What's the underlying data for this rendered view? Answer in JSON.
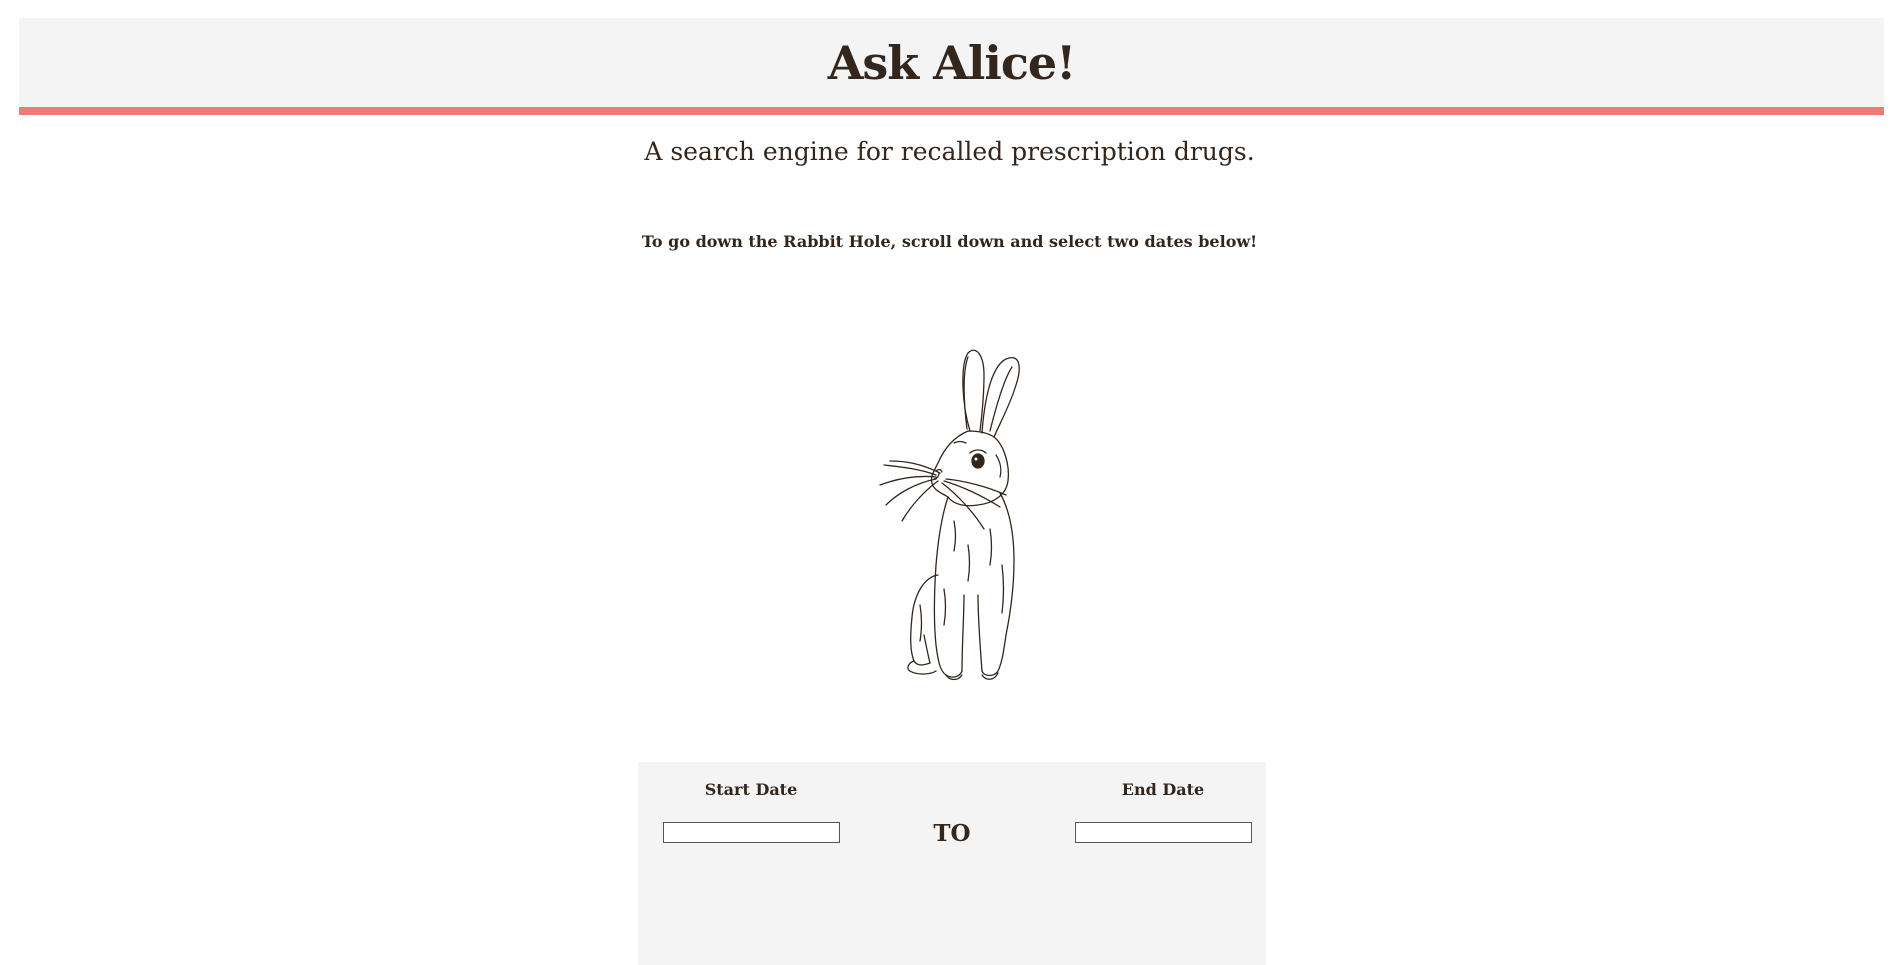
{
  "header": {
    "title": "Ask Alice!"
  },
  "hero": {
    "subtitle": "A search engine for recalled prescription drugs.",
    "instruction": "To go down the Rabbit Hole, scroll down and select two dates below!",
    "illustration_icon": "rabbit-sketch"
  },
  "date_range": {
    "start_label": "Start Date",
    "start_value": "",
    "end_label": "End Date",
    "end_value": "",
    "separator": "TO"
  },
  "colors": {
    "accent": "#ef7a7a",
    "text": "#33261d",
    "panel_bg": "#f4f4f4"
  }
}
